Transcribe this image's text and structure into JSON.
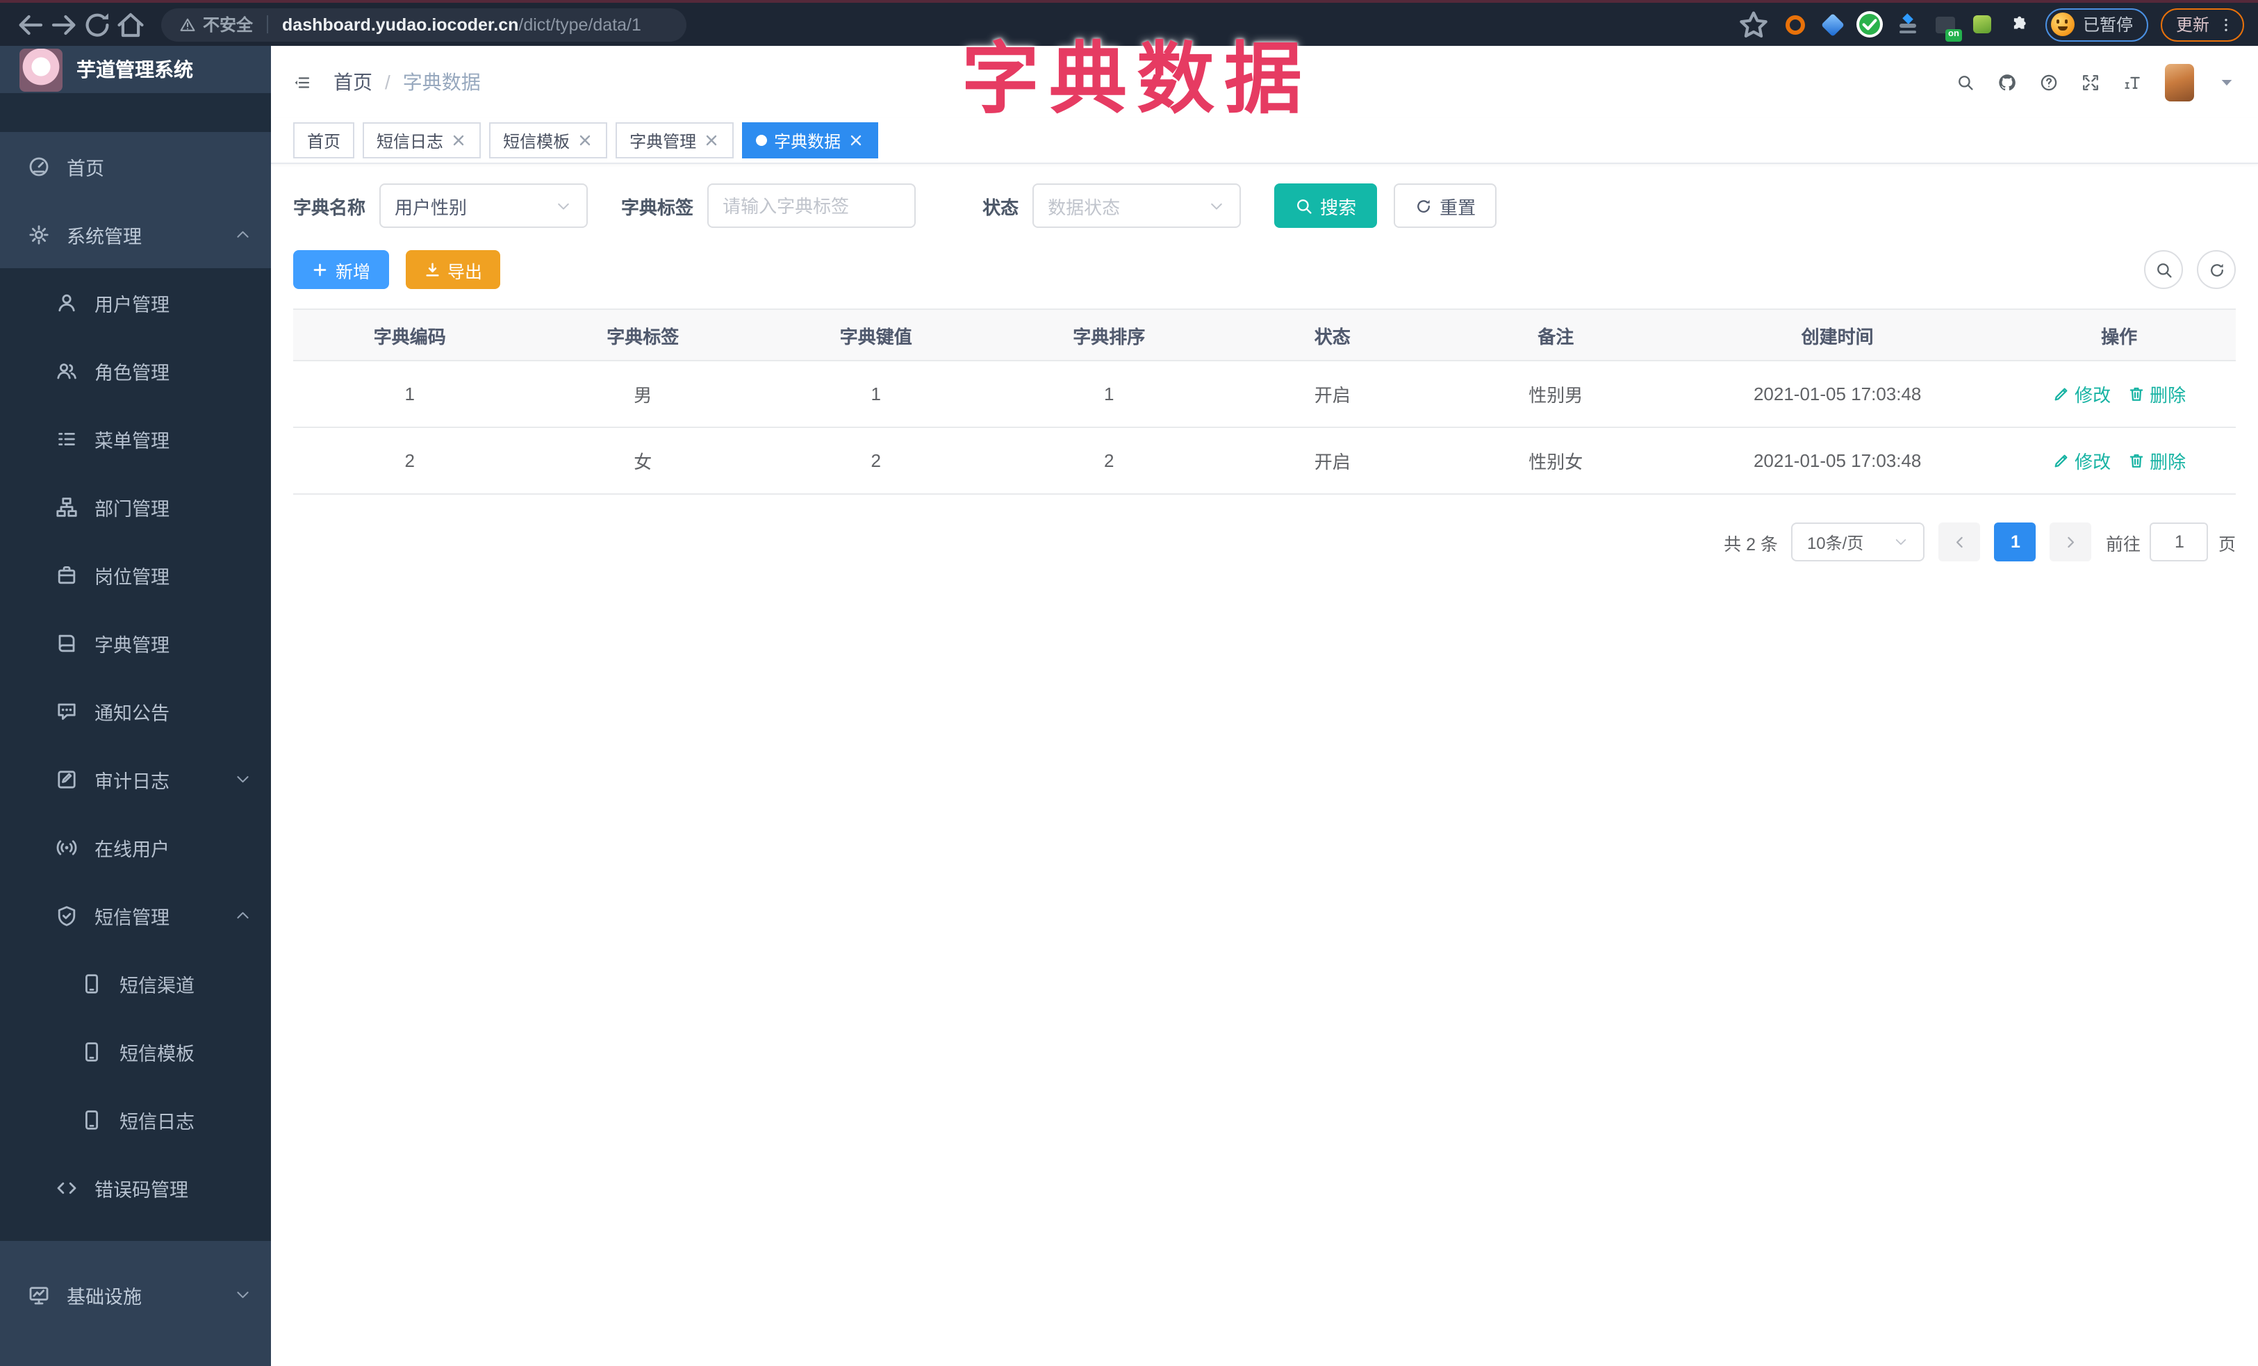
{
  "overlay_title": "字典数据",
  "browser": {
    "security_label": "不安全",
    "url_host": "dashboard.yudao.iocoder.cn",
    "url_path": "/dict/type/data/1",
    "paused_label": "已暂停",
    "update_label": "更新",
    "extensions": [
      {
        "icon": "ext-orange-ring-icon",
        "color": "#e8710a"
      },
      {
        "icon": "ext-blue-gem-icon",
        "color": "#1767d1"
      },
      {
        "icon": "ext-green-check-icon",
        "color": "#2bb24c"
      },
      {
        "icon": "ext-toggle-icon",
        "color": "#2f9bff"
      },
      {
        "icon": "ext-on-badge-icon",
        "color": "#39424e",
        "badge": "on",
        "badge_color": "#23b14d"
      },
      {
        "icon": "ext-green-sprite-icon",
        "color": "#5f9e2f"
      },
      {
        "icon": "extensions-puzzle-icon",
        "color": "#e8ecef"
      }
    ]
  },
  "sidebar": {
    "logo_title": "芋道管理系统",
    "items": [
      {
        "key": "home",
        "label": "首页",
        "icon": "dashboard-icon",
        "level": "top",
        "arrow": ""
      },
      {
        "key": "system-mgmt",
        "label": "系统管理",
        "icon": "gear-icon",
        "level": "top",
        "arrow": "up"
      },
      {
        "key": "user-mgmt",
        "label": "用户管理",
        "icon": "user-icon",
        "level": "sub",
        "arrow": ""
      },
      {
        "key": "role-mgmt",
        "label": "角色管理",
        "icon": "users-icon",
        "level": "sub",
        "arrow": ""
      },
      {
        "key": "menu-mgmt",
        "label": "菜单管理",
        "icon": "menu-list-icon",
        "level": "sub",
        "arrow": ""
      },
      {
        "key": "dept-mgmt",
        "label": "部门管理",
        "icon": "org-tree-icon",
        "level": "sub",
        "arrow": ""
      },
      {
        "key": "post-mgmt",
        "label": "岗位管理",
        "icon": "badge-icon",
        "level": "sub",
        "arrow": ""
      },
      {
        "key": "dict-mgmt",
        "label": "字典管理",
        "icon": "dict-book-icon",
        "level": "sub",
        "arrow": ""
      },
      {
        "key": "notice",
        "label": "通知公告",
        "icon": "announcement-icon",
        "level": "sub",
        "arrow": ""
      },
      {
        "key": "audit-log",
        "label": "审计日志",
        "icon": "audit-log-icon",
        "level": "sub",
        "arrow": "down"
      },
      {
        "key": "online-user",
        "label": "在线用户",
        "icon": "online-user-icon",
        "level": "sub",
        "arrow": ""
      },
      {
        "key": "sms-mgmt",
        "label": "短信管理",
        "icon": "shield-icon",
        "level": "sub",
        "arrow": "up"
      },
      {
        "key": "sms-channel",
        "label": "短信渠道",
        "icon": "phone-icon",
        "level": "sub2",
        "arrow": ""
      },
      {
        "key": "sms-template",
        "label": "短信模板",
        "icon": "phone-icon",
        "level": "sub2",
        "arrow": ""
      },
      {
        "key": "sms-log",
        "label": "短信日志",
        "icon": "phone-icon",
        "level": "sub2",
        "arrow": ""
      },
      {
        "key": "errcode-mgmt",
        "label": "错误码管理",
        "icon": "code-icon",
        "level": "sub",
        "arrow": ""
      },
      {
        "key": "infrastructure",
        "label": "基础设施",
        "icon": "infra-icon",
        "level": "top",
        "arrow": "down"
      }
    ]
  },
  "app_header": {
    "breadcrumb_home": "首页",
    "breadcrumb_sep": "/",
    "breadcrumb_current": "字典数据"
  },
  "tabs": [
    {
      "label": "首页",
      "closable": false,
      "active": false
    },
    {
      "label": "短信日志",
      "closable": true,
      "active": false
    },
    {
      "label": "短信模板",
      "closable": true,
      "active": false
    },
    {
      "label": "字典管理",
      "closable": true,
      "active": false
    },
    {
      "label": "字典数据",
      "closable": true,
      "active": true
    }
  ],
  "filters": {
    "dict_name_label": "字典名称",
    "dict_name_value": "用户性别",
    "dict_label_label": "字典标签",
    "dict_label_placeholder": "请输入字典标签",
    "status_label": "状态",
    "status_placeholder": "数据状态",
    "search_label": "搜索",
    "reset_label": "重置"
  },
  "toolbar": {
    "add_label": "新增",
    "export_label": "导出"
  },
  "table": {
    "columns": [
      "字典编码",
      "字典标签",
      "字典键值",
      "字典排序",
      "状态",
      "备注",
      "创建时间",
      "操作"
    ],
    "rows": [
      {
        "code": "1",
        "label": "男",
        "value": "1",
        "sort": "1",
        "status": "开启",
        "remark": "性别男",
        "created": "2021-01-05 17:03:48"
      },
      {
        "code": "2",
        "label": "女",
        "value": "2",
        "sort": "2",
        "status": "开启",
        "remark": "性别女",
        "created": "2021-01-05 17:03:48"
      }
    ],
    "edit_label": "修改",
    "delete_label": "删除"
  },
  "pagination": {
    "total_text": "共 2 条",
    "page_size_value": "10条/页",
    "current_page": "1",
    "goto_label": "前往",
    "goto_value": "1",
    "page_suffix": "页"
  },
  "colors": {
    "theme_teal": "#13b8a8",
    "link_teal": "#17b3a3",
    "primary_blue": "#409eff",
    "active_blue": "#2d8cf0",
    "warning_orange": "#f0a122",
    "overlay_pink": "#e63b62",
    "sidebar_bg": "#304156",
    "sidebar_sub_bg": "#1f2d3d",
    "browser_bar_bg": "#1d2634"
  }
}
